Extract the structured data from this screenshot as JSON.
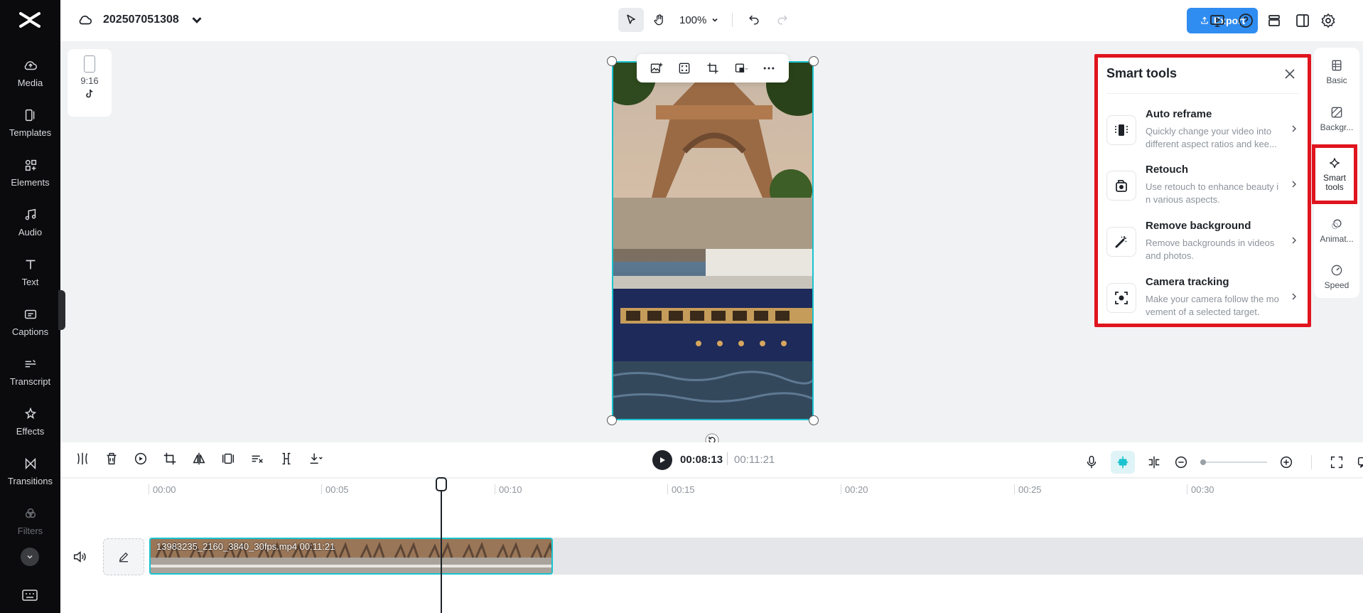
{
  "nav": {
    "items": [
      {
        "label": "Media",
        "icon": "cloud-upload-icon"
      },
      {
        "label": "Templates",
        "icon": "templates-icon"
      },
      {
        "label": "Elements",
        "icon": "elements-icon"
      },
      {
        "label": "Audio",
        "icon": "music-note-icon"
      },
      {
        "label": "Text",
        "icon": "text-icon"
      },
      {
        "label": "Captions",
        "icon": "captions-icon"
      },
      {
        "label": "Transcript",
        "icon": "transcript-icon"
      },
      {
        "label": "Effects",
        "icon": "effects-icon"
      },
      {
        "label": "Transitions",
        "icon": "transitions-icon"
      },
      {
        "label": "Filters",
        "icon": "filters-icon"
      }
    ]
  },
  "header": {
    "project_name": "202507051308",
    "zoom": "100%",
    "export_label": "Export"
  },
  "canvas": {
    "aspect_label": "9:16"
  },
  "smart_tools": {
    "title": "Smart tools",
    "tools": [
      {
        "name": "Auto reframe",
        "desc": "Quickly change your video into different aspect ratios and kee..."
      },
      {
        "name": "Retouch",
        "desc": "Use retouch to enhance beauty i n various aspects."
      },
      {
        "name": "Remove background",
        "desc": "Remove backgrounds in videos and photos."
      },
      {
        "name": "Camera tracking",
        "desc": "Make your camera follow the mo vement of a selected target."
      }
    ]
  },
  "side_tabs": [
    {
      "label": "Basic",
      "icon": "basic-icon"
    },
    {
      "label": "Backgr...",
      "icon": "background-icon"
    },
    {
      "label": "Smart tools",
      "icon": "sparkle-icon"
    },
    {
      "label": "Animat...",
      "icon": "animation-icon"
    },
    {
      "label": "Speed",
      "icon": "speed-icon"
    }
  ],
  "timeline": {
    "current_time": "00:08:13",
    "total_time": "00:11:21",
    "ruler": [
      "00:00",
      "00:05",
      "00:10",
      "00:15",
      "00:20",
      "00:25",
      "00:30"
    ],
    "clip_label": "13983235_2160_3840_30fps.mp4   00:11:21"
  },
  "colors": {
    "accent": "#2f8cf0",
    "selection": "#19c3cf",
    "highlight": "#e0141e"
  }
}
